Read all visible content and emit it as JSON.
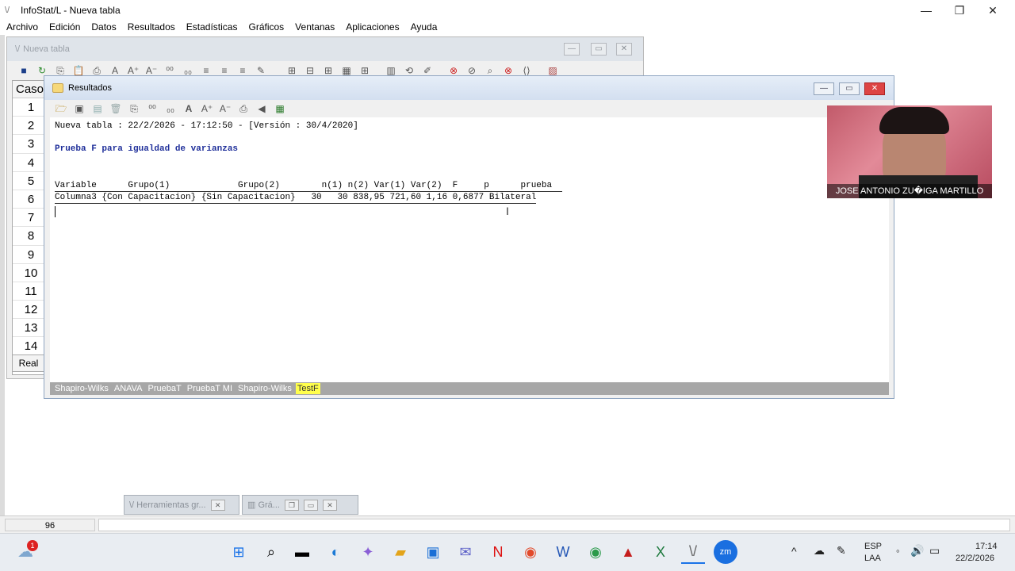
{
  "window": {
    "title": "InfoStat/L - Nueva tabla",
    "controls": [
      "—",
      "❐",
      "✕"
    ]
  },
  "menu": [
    "Archivo",
    "Edición",
    "Datos",
    "Resultados",
    "Estadísticas",
    "Gráficos",
    "Ventanas",
    "Aplicaciones",
    "Ayuda"
  ],
  "table_window": {
    "title": "Nueva tabla",
    "header": "Caso",
    "rows": [
      "1",
      "2",
      "3",
      "4",
      "5",
      "6",
      "7",
      "8",
      "9",
      "10",
      "11",
      "12",
      "13",
      "14"
    ],
    "tab": "Real"
  },
  "results_window": {
    "title": "Resultados",
    "header_line": "Nueva tabla : 22/2/2026 - 17:12:50 - [Versión : 30/4/2020]",
    "heading": "Prueba F para igualdad de varianzas",
    "table_head": "Variable      Grupo(1)             Grupo(2)        n(1) n(2) Var(1) Var(2)  F     p      prueba  ",
    "table_row": "Columna3 {Con Capacitacion} {Sin Capacitacion}   30   30 838,95 721,60 1,16 0,6877 Bilateral",
    "tabs": [
      "Shapiro-Wilks",
      "ANAVA",
      "PruebaT",
      "PruebaT MI",
      "Shapiro-Wilks",
      "TestF"
    ],
    "active_tab": "TestF"
  },
  "webcam": {
    "name": "JOSE ANTONIO ZU�IGA MARTILLO"
  },
  "minimized": [
    {
      "label": "Herramientas gr..."
    },
    {
      "label": "Grá..."
    }
  ],
  "status": {
    "count": "96"
  },
  "taskbar": {
    "weather_badge": "1",
    "lang": "ESP",
    "lang2": "LAA",
    "time": "17:14",
    "date": "22/2/2026"
  }
}
